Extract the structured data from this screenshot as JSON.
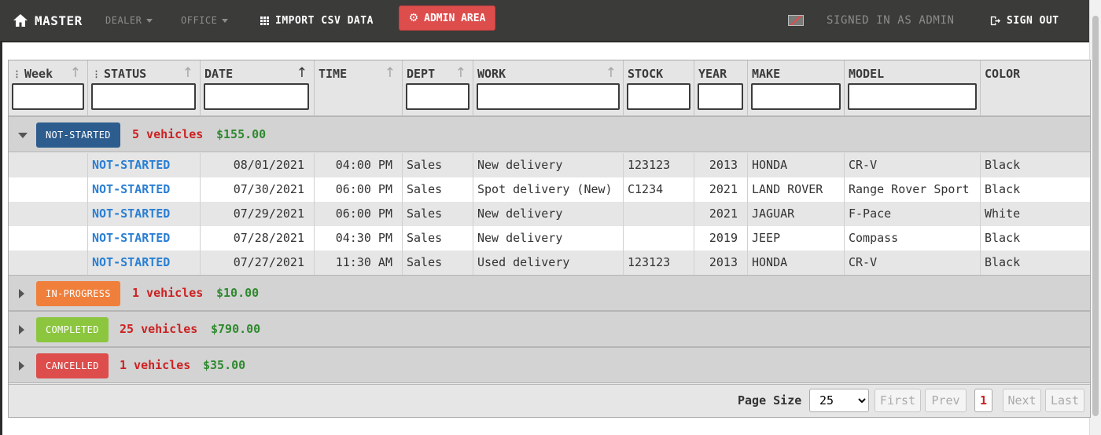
{
  "nav": {
    "brand": "MASTER",
    "dealer": "DEALER",
    "office": "OFFICE",
    "import": "IMPORT CSV DATA",
    "admin": "ADMIN AREA",
    "signed_in": "SIGNED IN AS ADMIN",
    "sign_out": "SIGN OUT"
  },
  "columns": [
    "Week",
    "STATUS",
    "DATE",
    "TIME",
    "DEPT",
    "WORK",
    "STOCK",
    "YEAR",
    "MAKE",
    "MODEL",
    "COLOR"
  ],
  "groups": [
    {
      "label": "NOT-STARTED",
      "count": "5 vehicles",
      "total": "$155.00",
      "color": "#2d5d8e",
      "expanded": true
    },
    {
      "label": "IN-PROGRESS",
      "count": "1 vehicles",
      "total": "$10.00",
      "color": "#f07f3c",
      "expanded": false
    },
    {
      "label": "COMPLETED",
      "count": "25 vehicles",
      "total": "$790.00",
      "color": "#8cc63f",
      "expanded": false
    },
    {
      "label": "CANCELLED",
      "count": "1 vehicles",
      "total": "$35.00",
      "color": "#dc4d4c",
      "expanded": false
    }
  ],
  "rows": [
    {
      "status": "NOT-STARTED",
      "date": "08/01/2021",
      "time": "04:00 PM",
      "dept": "Sales",
      "work": "New delivery",
      "stock": "123123",
      "year": "2013",
      "make": "HONDA",
      "model": "CR-V",
      "color": "Black"
    },
    {
      "status": "NOT-STARTED",
      "date": "07/30/2021",
      "time": "06:00 PM",
      "dept": "Sales",
      "work": "Spot delivery (New)",
      "stock": "C1234",
      "year": "2021",
      "make": "LAND ROVER",
      "model": "Range Rover Sport",
      "color": "Black"
    },
    {
      "status": "NOT-STARTED",
      "date": "07/29/2021",
      "time": "06:00 PM",
      "dept": "Sales",
      "work": "New delivery",
      "stock": "",
      "year": "2021",
      "make": "JAGUAR",
      "model": "F-Pace",
      "color": "White"
    },
    {
      "status": "NOT-STARTED",
      "date": "07/28/2021",
      "time": "04:30 PM",
      "dept": "Sales",
      "work": "New delivery",
      "stock": "",
      "year": "2019",
      "make": "JEEP",
      "model": "Compass",
      "color": "Black"
    },
    {
      "status": "NOT-STARTED",
      "date": "07/27/2021",
      "time": "11:30 AM",
      "dept": "Sales",
      "work": "Used delivery",
      "stock": "123123",
      "year": "2013",
      "make": "HONDA",
      "model": "CR-V",
      "color": "Black"
    }
  ],
  "pager": {
    "page_size_label": "Page Size",
    "page_size": "25",
    "first": "First",
    "prev": "Prev",
    "current": "1",
    "next": "Next",
    "last": "Last"
  }
}
